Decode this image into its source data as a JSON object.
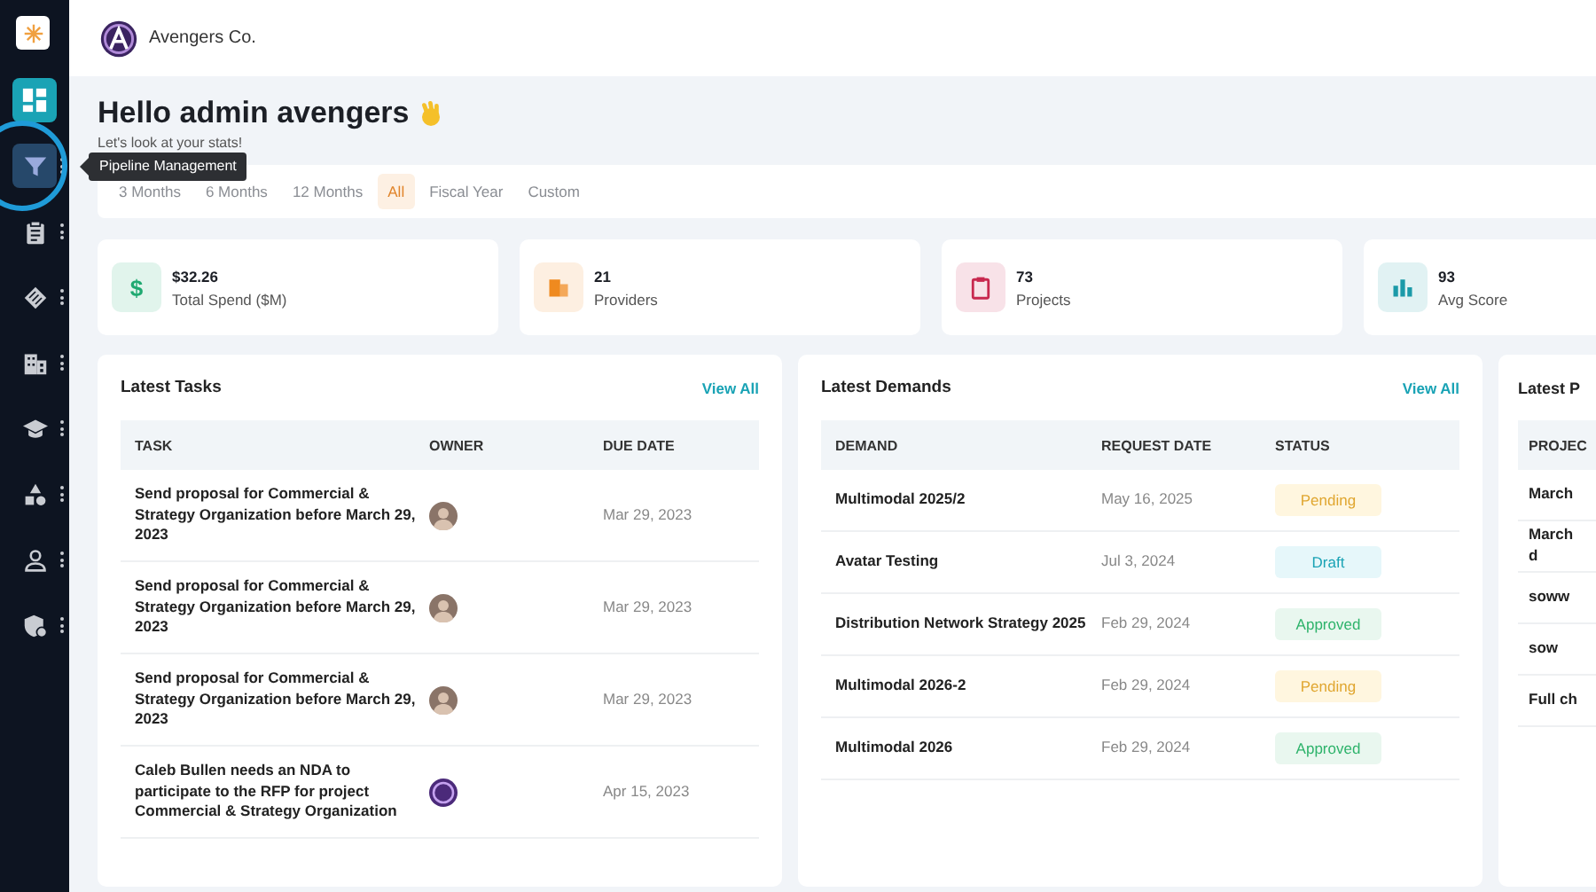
{
  "company": {
    "name": "Avengers Co."
  },
  "sidebar": {
    "items": [
      {
        "kind": "dashboard",
        "selected": true,
        "highlighted": false,
        "menu": false
      },
      {
        "kind": "funnel",
        "selected": false,
        "highlighted": true,
        "menu": true
      },
      {
        "kind": "clipboard",
        "selected": false,
        "highlighted": false,
        "menu": true
      },
      {
        "kind": "tag",
        "selected": false,
        "highlighted": false,
        "menu": true
      },
      {
        "kind": "building",
        "selected": false,
        "highlighted": false,
        "menu": true
      },
      {
        "kind": "cap",
        "selected": false,
        "highlighted": false,
        "menu": true
      },
      {
        "kind": "shapes",
        "selected": false,
        "highlighted": false,
        "menu": true
      },
      {
        "kind": "person",
        "selected": false,
        "highlighted": false,
        "menu": true
      },
      {
        "kind": "shield",
        "selected": false,
        "highlighted": false,
        "menu": true
      }
    ],
    "tooltip": "Pipeline Management"
  },
  "greeting": {
    "title": "Hello admin avengers",
    "subtitle": "Let's look at your stats!"
  },
  "periods": [
    {
      "label": "3 Months",
      "selected": false
    },
    {
      "label": "6 Months",
      "selected": false
    },
    {
      "label": "12 Months",
      "selected": false
    },
    {
      "label": "All",
      "selected": true
    },
    {
      "label": "Fiscal Year",
      "selected": false
    },
    {
      "label": "Custom",
      "selected": false
    }
  ],
  "stats": [
    {
      "kind": "money",
      "symbol": "$",
      "value": "$32.26",
      "label": "Total Spend ($M)",
      "color": "#1fa971"
    },
    {
      "kind": "building",
      "value": "21",
      "label": "Providers",
      "color": "#ef8a1f"
    },
    {
      "kind": "clipboard",
      "value": "73",
      "label": "Projects",
      "color": "#c8284f"
    },
    {
      "kind": "chart",
      "value": "93",
      "label": "Avg Score",
      "color": "#1b9aa8"
    }
  ],
  "tasks": {
    "title": "Latest Tasks",
    "link": "View All",
    "columns": [
      "TASK",
      "OWNER",
      "DUE DATE"
    ],
    "rows": [
      {
        "task": "Send proposal for Commercial & Strategy Organization before March 29, 2023",
        "owner": {
          "kind": "photo"
        },
        "due": "Mar 29, 2023"
      },
      {
        "task": "Send proposal for Commercial & Strategy Organization before March 29, 2023",
        "owner": {
          "kind": "photo"
        },
        "due": "Mar 29, 2023"
      },
      {
        "task": "Send proposal for Commercial & Strategy Organization before March 29, 2023",
        "owner": {
          "kind": "photo"
        },
        "due": "Mar 29, 2023"
      },
      {
        "task": "Caleb Bullen needs an NDA to participate to the RFP for project Commercial & Strategy Organization",
        "owner": {
          "kind": "logo"
        },
        "due": "Apr 15, 2023"
      }
    ]
  },
  "demands": {
    "title": "Latest Demands",
    "link": "View All",
    "columns": [
      "DEMAND",
      "REQUEST DATE",
      "STATUS"
    ],
    "rows": [
      {
        "demand": "Multimodal 2025/2",
        "date": "May 16, 2025",
        "status": {
          "label": "Pending",
          "kind": "pending"
        }
      },
      {
        "demand": "Avatar Testing",
        "date": "Jul 3, 2024",
        "status": {
          "label": "Draft",
          "kind": "draft"
        }
      },
      {
        "demand": "Distribution Network Strategy 2025",
        "date": "Feb 29, 2024",
        "status": {
          "label": "Approved",
          "kind": "approved"
        }
      },
      {
        "demand": "Multimodal 2026-2",
        "date": "Feb 29, 2024",
        "status": {
          "label": "Pending",
          "kind": "pending"
        }
      },
      {
        "demand": "Multimodal 2026",
        "date": "Feb 29, 2024",
        "status": {
          "label": "Approved",
          "kind": "approved"
        }
      }
    ]
  },
  "projects": {
    "title": "Latest P",
    "column": "PROJEC",
    "rows": [
      "March",
      "March\nd",
      "soww",
      "sow",
      "Full ch"
    ]
  }
}
